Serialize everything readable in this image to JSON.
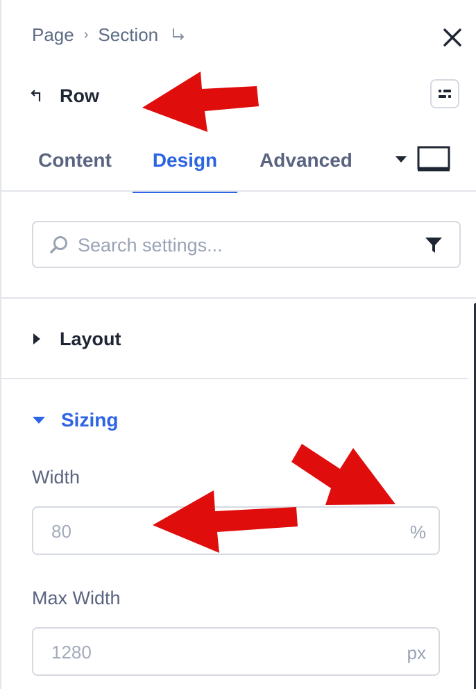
{
  "breadcrumb": {
    "items": [
      "Page",
      "Section"
    ]
  },
  "header": {
    "title": "Row"
  },
  "tabs": [
    {
      "label": "Content"
    },
    {
      "label": "Design"
    },
    {
      "label": "Advanced"
    }
  ],
  "active_tab": "Design",
  "search": {
    "placeholder": "Search settings..."
  },
  "sections": {
    "layout": {
      "label": "Layout",
      "expanded": false
    },
    "sizing": {
      "label": "Sizing",
      "expanded": true
    }
  },
  "fields": {
    "width": {
      "label": "Width",
      "placeholder": "80",
      "unit": "%"
    },
    "max_width": {
      "label": "Max Width",
      "placeholder": "1280",
      "unit": "px"
    }
  },
  "icons": {
    "close": "close-icon",
    "enter": "enter-arrow-icon",
    "back": "back-arrow-icon",
    "options": "options-icon",
    "dropdown": "caret-down-icon",
    "device": "desktop-icon",
    "search": "search-icon",
    "filter": "filter-icon"
  },
  "colors": {
    "accent": "#2c64e3",
    "text_primary": "#1f2633",
    "text_secondary": "#5a6480",
    "annotation_arrow": "#e00d0d"
  }
}
